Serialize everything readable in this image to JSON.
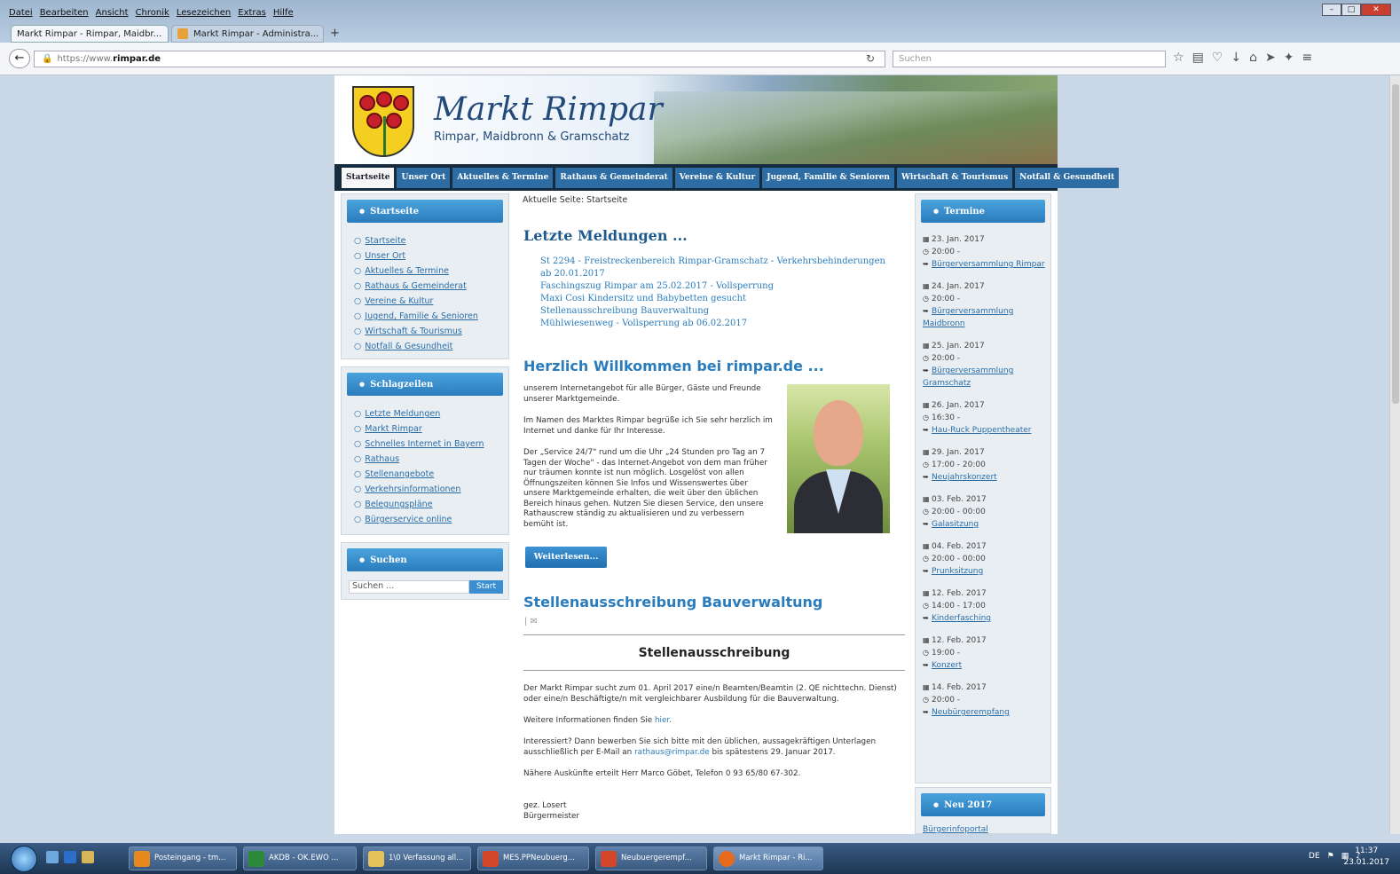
{
  "browser": {
    "menu": [
      "Datei",
      "Bearbeiten",
      "Ansicht",
      "Chronik",
      "Lesezeichen",
      "Extras",
      "Hilfe"
    ],
    "tabs": [
      {
        "title": "Markt Rimpar - Rimpar, Maidbr..."
      },
      {
        "title": "Markt Rimpar - Administra..."
      }
    ],
    "url_prefix": "https://www.",
    "url_domain": "rimpar.de",
    "search_placeholder": "Suchen"
  },
  "site": {
    "title": "Markt Rimpar",
    "subtitle": "Rimpar, Maidbronn & Gramschatz",
    "nav": [
      "Startseite",
      "Unser Ort",
      "Aktuelles & Termine",
      "Rathaus & Gemeinderat",
      "Vereine & Kultur",
      "Jugend, Familie & Senioren",
      "Wirtschaft & Tourismus",
      "Notfall & Gesundheit"
    ]
  },
  "sidebar": {
    "start_title": "Startseite",
    "start_items": [
      "Startseite",
      "Unser Ort",
      "Aktuelles & Termine",
      "Rathaus & Gemeinderat",
      "Vereine & Kultur",
      "Jugend, Familie & Senioren",
      "Wirtschaft & Tourismus",
      "Notfall & Gesundheit"
    ],
    "schlag_title": "Schlagzeilen",
    "schlag_items": [
      "Letzte Meldungen",
      "Markt Rimpar",
      "Schnelles Internet in Bayern",
      "Rathaus",
      "Stellenangebote",
      "Verkehrsinformationen",
      "Belegungspläne",
      "Bürgerservice online"
    ],
    "search_title": "Suchen",
    "search_placeholder": "Suchen ...",
    "search_button": "Start"
  },
  "content": {
    "breadcrumb": "Aktuelle Seite: Startseite",
    "news_heading": "Letzte Meldungen ...",
    "news": [
      "St 2294 - Freistreckenbereich Rimpar-Gramschatz - Verkehrsbehinderungen ab 20.01.2017",
      "Faschingszug Rimpar am 25.02.2017 - Vollsperrung",
      "Maxi Cosi Kindersitz und Babybetten gesucht",
      "Stellenausschreibung Bauverwaltung",
      "Mühlwiesenweg - Vollsperrung ab 06.02.2017"
    ],
    "welcome_heading": "Herzlich Willkommen bei rimpar.de ...",
    "welcome_p1": "unserem Internetangebot für alle Bürger, Gäste und Freunde unserer Marktgemeinde.",
    "welcome_p2": "Im Namen des Marktes Rimpar begrüße ich Sie sehr herzlich im Internet und danke für Ihr Interesse.",
    "welcome_p3": "Der „Service 24/7\" rund um die Uhr „24 Stunden pro Tag an 7 Tagen der Woche\" - das Internet-Angebot von dem man früher nur träumen konnte ist nun möglich. Losgelöst von allen Öffnungszeiten können Sie Infos und Wissenswertes über unsere Marktgemeinde erhalten, die weit über den üblichen Bereich hinaus gehen. Nutzen Sie diesen Service, den unsere Rathauscrew ständig zu aktualisieren und zu verbessern bemüht ist.",
    "readmore": "Weiterlesen...",
    "job_heading": "Stellenausschreibung Bauverwaltung",
    "job_subheading": "Stellenausschreibung",
    "job_p1": "Der Markt Rimpar sucht zum 01. April 2017 eine/n Beamten/Beamtin (2. QE nichttechn. Dienst) oder eine/n Beschäftigte/n mit vergleichbarer Ausbildung für die Bauverwaltung.",
    "job_p2_pre": "Weitere Informationen finden Sie ",
    "job_p2_link": "hier",
    "job_p3_pre": "Interessiert? Dann bewerben Sie sich bitte mit den üblichen, aussagekräftigen Unterlagen ausschließlich per E-Mail an ",
    "job_p3_link": "rathaus@rimpar.de",
    "job_p3_post": " bis spätestens 29. Januar 2017.",
    "job_p4": "Nähere Auskünfte erteilt Herr Marco Göbet, Telefon 0 93 65/80 67-302.",
    "job_sign1": "gez. Losert",
    "job_sign2": "Bürgermeister"
  },
  "termine": {
    "title": "Termine",
    "items": [
      {
        "date": "23. Jan. 2017",
        "time": "20:00 -",
        "event": "Bürgerversammlung Rimpar"
      },
      {
        "date": "24. Jan. 2017",
        "time": "20:00 -",
        "event": "Bürgerversammlung Maidbronn"
      },
      {
        "date": "25. Jan. 2017",
        "time": "20:00 -",
        "event": "Bürgerversammlung Gramschatz"
      },
      {
        "date": "26. Jan. 2017",
        "time": "16:30 -",
        "event": "Hau-Ruck Puppentheater"
      },
      {
        "date": "29. Jan. 2017",
        "time": "17:00 - 20:00",
        "event": "Neujahrskonzert"
      },
      {
        "date": "03. Feb. 2017",
        "time": "20:00 - 00:00",
        "event": "Galasitzung"
      },
      {
        "date": "04. Feb. 2017",
        "time": "20:00 - 00:00",
        "event": "Prunksitzung"
      },
      {
        "date": "12. Feb. 2017",
        "time": "14:00 - 17:00",
        "event": "Kinderfasching"
      },
      {
        "date": "12. Feb. 2017",
        "time": "19:00 -",
        "event": "Konzert"
      },
      {
        "date": "14. Feb. 2017",
        "time": "20:00 -",
        "event": "Neubürgerempfang"
      }
    ],
    "neu_title": "Neu 2017",
    "neu_link": "Bürgerinfoportal"
  },
  "taskbar": {
    "tasks": [
      "Posteingang - tm...",
      "AKDB - OK.EWO ...",
      "1\\0 Verfassung all...",
      "MES.PPNeubuerg...",
      "Neubuergerempf...",
      "Markt Rimpar - Ri..."
    ],
    "lang": "DE",
    "time": "11:37",
    "date": "23.01.2017"
  },
  "colors": {
    "accent": "#2a7cbc",
    "nav_bg": "#162b3e",
    "heading": "#1f5a8e"
  }
}
